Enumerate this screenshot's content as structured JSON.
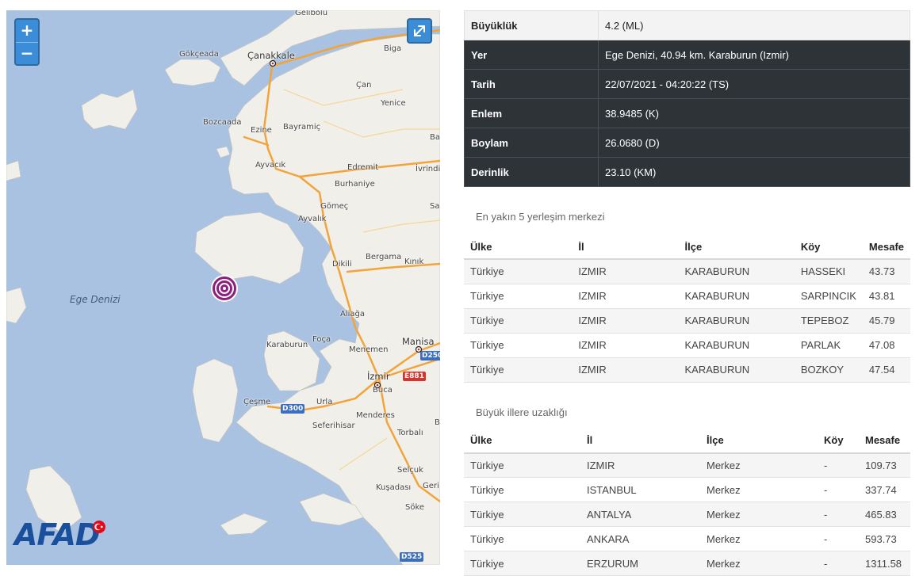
{
  "map": {
    "zoom_in": "+",
    "zoom_out": "−",
    "fullscreen_icon": "expand-icon",
    "sea_label": "Ege Denizi",
    "places": {
      "gelibolu": "Gelibolu",
      "canakkale": "Çanakkale",
      "gokceada": "Gökçeada",
      "biga": "Biga",
      "can": "Çan",
      "yenice": "Yenice",
      "bozcaada": "Bozcaada",
      "ezine": "Ezine",
      "bayramic": "Bayramiç",
      "ba": "Ba",
      "ayvacik": "Ayvacık",
      "edremit": "Edremit",
      "ivrindi": "İvrindi",
      "burhaniye": "Burhaniye",
      "gomec": "Gömeç",
      "ayvalik": "Ayvalık",
      "sa": "Sa",
      "dikili": "Dikili",
      "bergama": "Bergama",
      "kinik": "Kınık",
      "aliaga": "Aliağa",
      "karaburun": "Karaburun",
      "foca": "Foça",
      "menemen": "Menemen",
      "manisa": "Manisa",
      "izmir": "İzmir",
      "buca": "Buca",
      "cesme": "Çeşme",
      "urla": "Urla",
      "seferihisar": "Seferihisar",
      "menderes": "Menderes",
      "torbali": "Torbalı",
      "b": "B",
      "selcuk": "Selçuk",
      "kusadasi": "Kuşadası",
      "geri": "Geri",
      "soke": "Söke"
    },
    "shields": {
      "d250": "D250",
      "e881": "E881",
      "d300": "D300",
      "d525": "D525"
    },
    "logo_text": "AFAD"
  },
  "details": [
    {
      "key": "Büyüklük",
      "value": "4.2 (ML)"
    },
    {
      "key": "Yer",
      "value": "Ege Denizi, 40.94 km. Karaburun (Izmir)"
    },
    {
      "key": "Tarih",
      "value": "22/07/2021 - 04:20:22 (TS)"
    },
    {
      "key": "Enlem",
      "value": "38.9485 (K)"
    },
    {
      "key": "Boylam",
      "value": "26.0680 (D)"
    },
    {
      "key": "Derinlik",
      "value": "23.10 (KM)"
    }
  ],
  "nearest": {
    "title": "En yakın 5 yerleşim merkezi",
    "headers": [
      "Ülke",
      "İl",
      "İlçe",
      "Köy",
      "Mesafe"
    ],
    "rows": [
      [
        "Türkiye",
        "IZMIR",
        "KARABURUN",
        "HASSEKI",
        "43.73"
      ],
      [
        "Türkiye",
        "IZMIR",
        "KARABURUN",
        "SARPINCIK",
        "43.81"
      ],
      [
        "Türkiye",
        "IZMIR",
        "KARABURUN",
        "TEPEBOZ",
        "45.79"
      ],
      [
        "Türkiye",
        "IZMIR",
        "KARABURUN",
        "PARLAK",
        "47.08"
      ],
      [
        "Türkiye",
        "IZMIR",
        "KARABURUN",
        "BOZKOY",
        "47.54"
      ]
    ]
  },
  "cities": {
    "title": "Büyük illere uzaklığı",
    "headers": [
      "Ülke",
      "İl",
      "İlçe",
      "Köy",
      "Mesafe"
    ],
    "rows": [
      [
        "Türkiye",
        "IZMIR",
        "Merkez",
        "-",
        "109.73"
      ],
      [
        "Türkiye",
        "ISTANBUL",
        "Merkez",
        "-",
        "337.74"
      ],
      [
        "Türkiye",
        "ANTALYA",
        "Merkez",
        "-",
        "465.83"
      ],
      [
        "Türkiye",
        "ANKARA",
        "Merkez",
        "-",
        "593.73"
      ],
      [
        "Türkiye",
        "ERZURUM",
        "Merkez",
        "-",
        "1311.58"
      ]
    ]
  }
}
